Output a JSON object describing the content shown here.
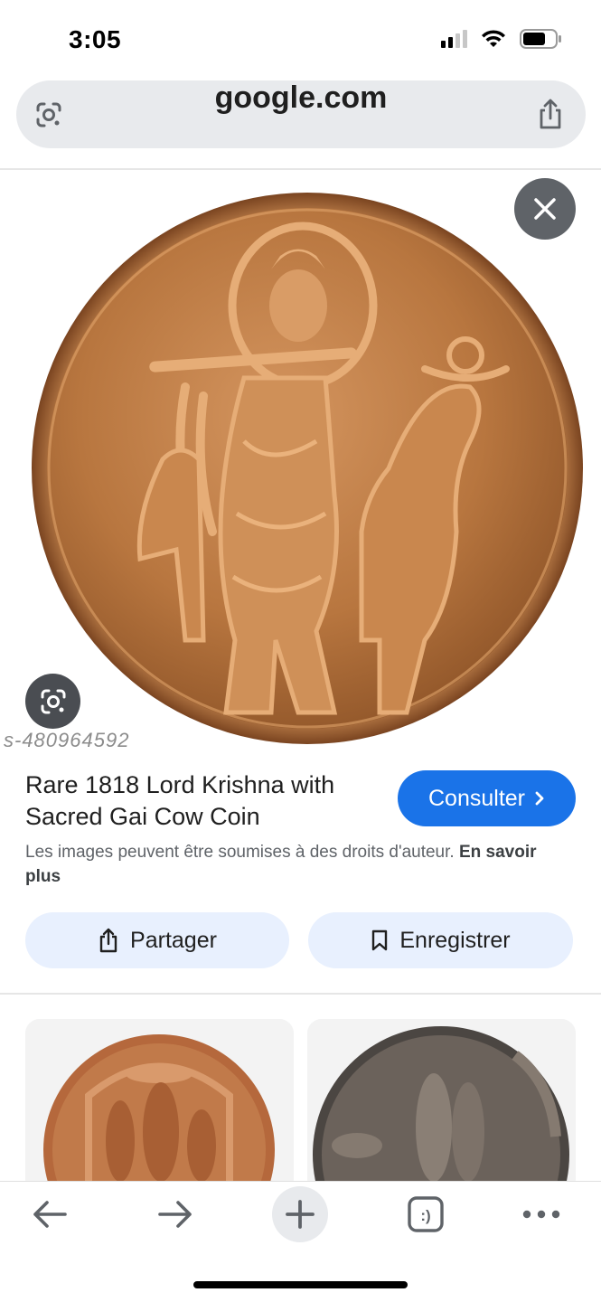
{
  "status_bar": {
    "time": "3:05"
  },
  "url_bar": {
    "domain": "google.com"
  },
  "image": {
    "watermark": "s-480964592"
  },
  "result": {
    "title": "Rare 1818 Lord Krishna with Sacred Gai Cow Coin",
    "visit_label": "Consulter",
    "copyright_text": "Les images peuvent être soumises à des droits d'auteur.",
    "learn_more": "En savoir plus"
  },
  "actions": {
    "share_label": "Partager",
    "save_label": "Enregistrer"
  },
  "toolbar": {
    "tabs_glyph": ":)",
    "icons": [
      "back-arrow-icon",
      "forward-arrow-icon",
      "plus-icon",
      "tabs-icon",
      "more-icon"
    ]
  },
  "colors": {
    "accent": "#1a73e8",
    "chip": "#e8f0fe",
    "coin": "#b0703f"
  }
}
